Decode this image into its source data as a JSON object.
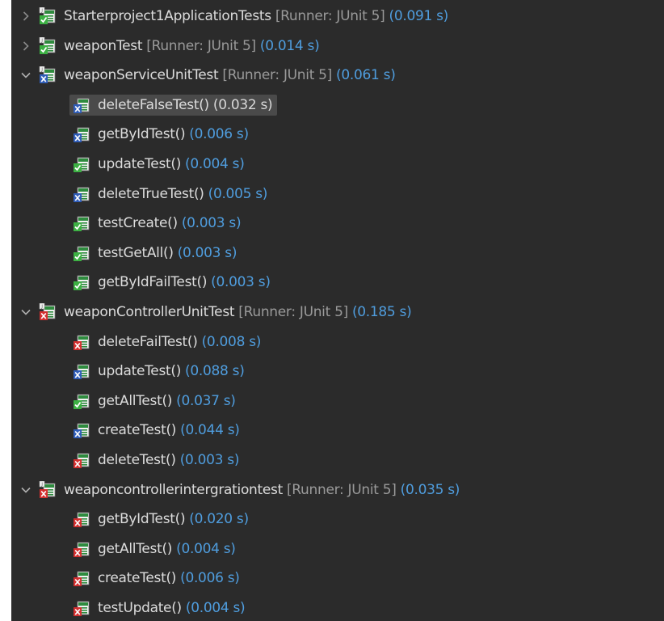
{
  "tree": {
    "suites": [
      {
        "name": "Starterproject1ApplicationTests",
        "runner": "[Runner: JUnit 5]",
        "time": "(0.091 s)",
        "status": "pass",
        "expanded": false,
        "tests": []
      },
      {
        "name": "weaponTest",
        "runner": "[Runner: JUnit 5]",
        "time": "(0.014 s)",
        "status": "pass",
        "expanded": false,
        "tests": []
      },
      {
        "name": "weaponServiceUnitTest",
        "runner": "[Runner: JUnit 5]",
        "time": "(0.061 s)",
        "status": "fail",
        "expanded": true,
        "tests": [
          {
            "name": "deleteFalseTest()",
            "time": "(0.032 s)",
            "status": "fail",
            "selected": true
          },
          {
            "name": "getByIdTest()",
            "time": "(0.006 s)",
            "status": "fail"
          },
          {
            "name": "updateTest()",
            "time": "(0.004 s)",
            "status": "pass"
          },
          {
            "name": "deleteTrueTest()",
            "time": "(0.005 s)",
            "status": "fail"
          },
          {
            "name": "testCreate()",
            "time": "(0.003 s)",
            "status": "pass"
          },
          {
            "name": "testGetAll()",
            "time": "(0.003 s)",
            "status": "pass"
          },
          {
            "name": "getByIdFailTest()",
            "time": "(0.003 s)",
            "status": "pass"
          }
        ]
      },
      {
        "name": "weaponControllerUnitTest",
        "runner": "[Runner: JUnit 5]",
        "time": "(0.185 s)",
        "status": "error",
        "expanded": true,
        "tests": [
          {
            "name": "deleteFailTest()",
            "time": "(0.008 s)",
            "status": "error"
          },
          {
            "name": "updateTest()",
            "time": "(0.088 s)",
            "status": "fail"
          },
          {
            "name": "getAllTest()",
            "time": "(0.037 s)",
            "status": "pass"
          },
          {
            "name": "createTest()",
            "time": "(0.044 s)",
            "status": "fail"
          },
          {
            "name": "deleteTest()",
            "time": "(0.003 s)",
            "status": "error"
          }
        ]
      },
      {
        "name": "weaponcontrollerintergrationtest",
        "runner": "[Runner: JUnit 5]",
        "time": "(0.035 s)",
        "status": "error",
        "expanded": true,
        "tests": [
          {
            "name": "getByIdTest()",
            "time": "(0.020 s)",
            "status": "error"
          },
          {
            "name": "getAllTest()",
            "time": "(0.004 s)",
            "status": "error"
          },
          {
            "name": "createTest()",
            "time": "(0.006 s)",
            "status": "error"
          },
          {
            "name": "testUpdate()",
            "time": "(0.004 s)",
            "status": "error"
          }
        ]
      }
    ]
  },
  "icons": {
    "collapsed": "chevron-right-icon",
    "expanded": "chevron-down-icon",
    "suite": "test-suite-icon",
    "test": "test-method-icon"
  },
  "colors": {
    "background": "#2b2b2b",
    "text": "#dcdcdc",
    "runner": "#9a9a9a",
    "time": "#4f9dde",
    "selection": "#4a4a4a",
    "pass": "#3cb043",
    "fail": "#2f5db8",
    "error": "#d32f2f"
  }
}
